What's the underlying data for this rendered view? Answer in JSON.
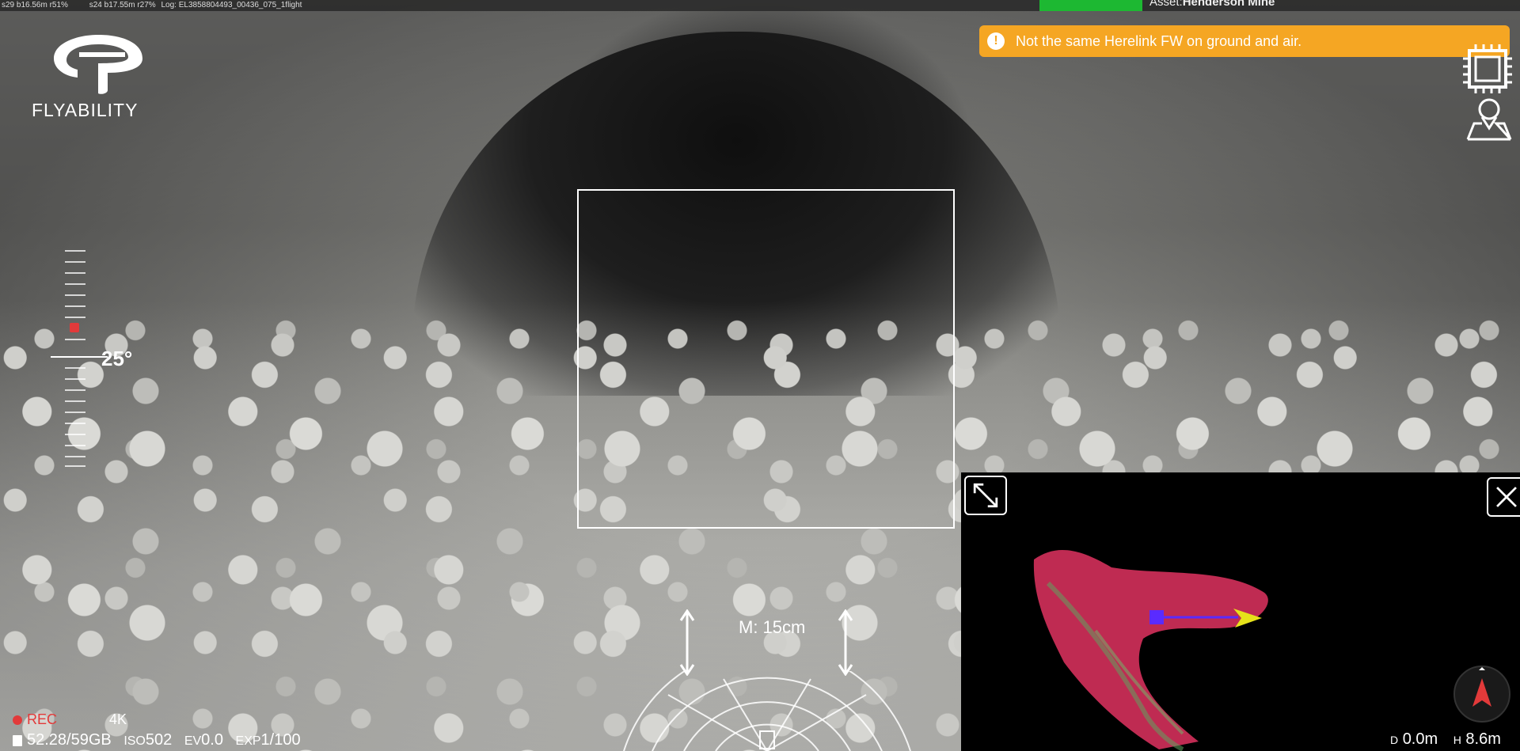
{
  "topbar": {
    "telemetry_1": "s29 b16.56m r51%",
    "telemetry_2": "s24 b17.55m r27%",
    "log": "Log: EL3858804493_00436_075_1flight",
    "asset_label": "Asset:",
    "asset_name": "Henderson Mine"
  },
  "logo": {
    "wordmark": "FLYABILITY"
  },
  "warning": {
    "icon": "!",
    "text": "Not the same Herelink FW on ground and air."
  },
  "pitch": {
    "value": "25°"
  },
  "measure": {
    "label": "M: 15cm"
  },
  "recording": {
    "state": "REC",
    "resolution": "4K"
  },
  "stats": {
    "storage": "52.28/59GB",
    "iso_label": "ISO",
    "iso_value": "502",
    "ev_label": "EV",
    "ev_value": "0.0",
    "exp_label": "EXP",
    "exp_value": "1/100"
  },
  "minimap": {
    "d_label": "D",
    "d_value": "0.0m",
    "h_label": "H",
    "h_value": "8.6m"
  },
  "colors": {
    "warning": "#f5a623",
    "connected": "#1db832",
    "record": "#e23a3a",
    "drone_marker": "#5a2bff",
    "heading_arrow": "#e6e21a",
    "pointcloud": "#ff3a6e"
  },
  "icons": {
    "logo": "flyability-logo-icon",
    "warning": "warning-icon",
    "chip": "chip-icon",
    "map_pin": "map-pin-icon",
    "expand": "expand-icon",
    "close": "close-icon",
    "compass": "compass-icon",
    "storage": "sd-card-icon"
  }
}
